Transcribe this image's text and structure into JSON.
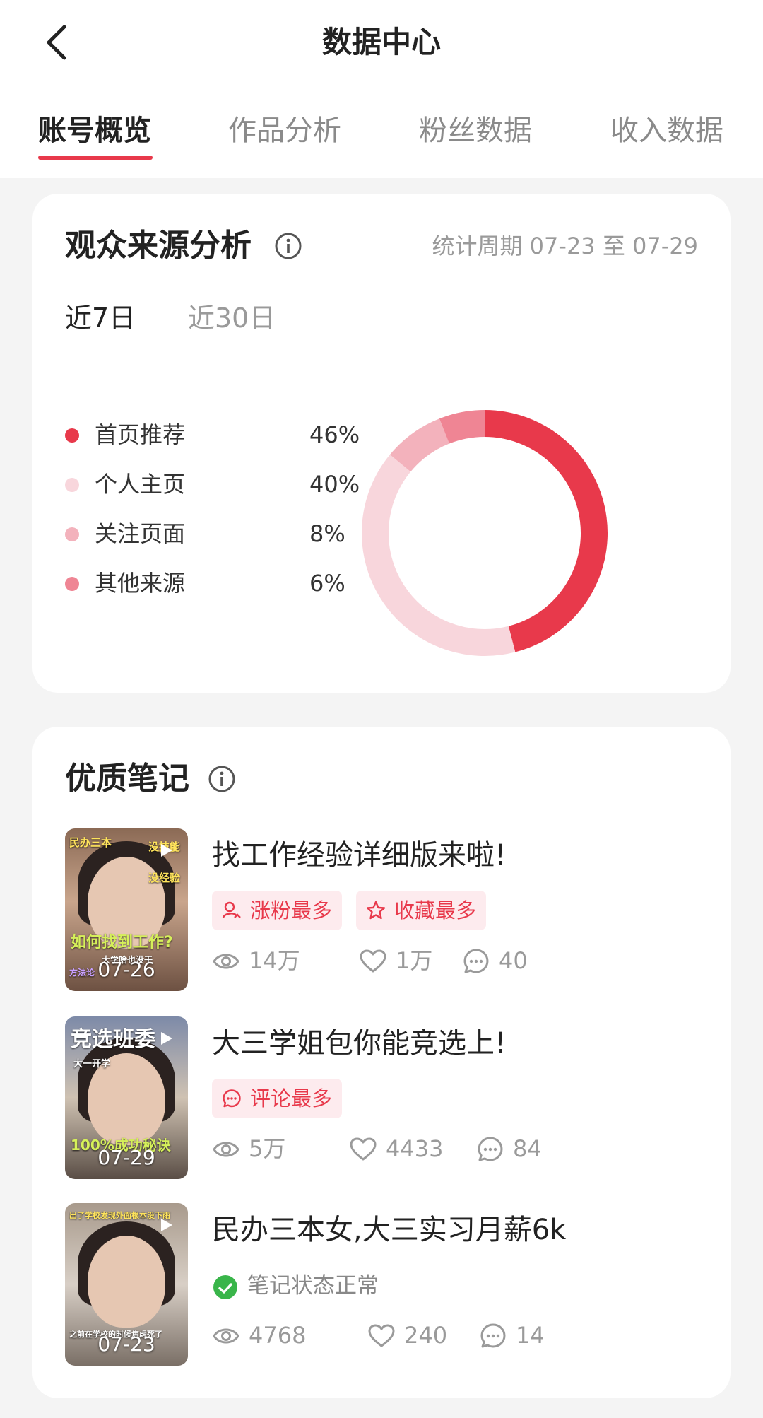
{
  "header": {
    "title": "数据中心",
    "back_icon": "chevron-left-icon"
  },
  "tabs": [
    {
      "label": "账号概览",
      "active": true
    },
    {
      "label": "作品分析",
      "active": false
    },
    {
      "label": "粉丝数据",
      "active": false
    },
    {
      "label": "收入数据",
      "active": false
    }
  ],
  "colors": {
    "accent": "#e8394b",
    "badge_bg": "#fdebee",
    "ok_green": "#39b54a"
  },
  "audience": {
    "title": "观众来源分析",
    "period": "统计周期 07-23 至 07-29",
    "ranges": [
      {
        "label": "近7日",
        "active": true
      },
      {
        "label": "近30日",
        "active": false
      }
    ],
    "legend": [
      {
        "label": "首页推荐",
        "value_text": "46%",
        "color": "#e8394b"
      },
      {
        "label": "个人主页",
        "value_text": "40%",
        "color": "#f8d6dc"
      },
      {
        "label": "关注页面",
        "value_text": "8%",
        "color": "#f3b2bc"
      },
      {
        "label": "其他来源",
        "value_text": "6%",
        "color": "#ef8594"
      }
    ]
  },
  "chart_data": {
    "type": "pie",
    "donut": true,
    "categories": [
      "首页推荐",
      "个人主页",
      "关注页面",
      "其他来源"
    ],
    "values": [
      46,
      40,
      8,
      6
    ],
    "colors": [
      "#e8394b",
      "#f8d6dc",
      "#f3b2bc",
      "#ef8594"
    ],
    "legend": "left"
  },
  "quality": {
    "title": "优质笔记",
    "notes": [
      {
        "title": "找工作经验详细版来啦!",
        "date": "07-26",
        "thumb_texts": {
          "top_left": "民办三本",
          "right1": "没技能",
          "right2": "没经验",
          "big": "如何找到工作?",
          "small": "大学啥也没干",
          "small2": "方法论"
        },
        "badges": [
          {
            "label": "涨粉最多",
            "icon": "user-plus-icon"
          },
          {
            "label": "收藏最多",
            "icon": "star-icon"
          }
        ],
        "views": "14万",
        "likes": "1万",
        "comments": "40"
      },
      {
        "title": "大三学姐包你能竞选上!",
        "date": "07-29",
        "thumb_texts": {
          "top_left": "竞选班委",
          "small": "大一开学",
          "big": "100%成功秘诀"
        },
        "badges": [
          {
            "label": "评论最多",
            "icon": "comment-icon"
          }
        ],
        "views": "5万",
        "likes": "4433",
        "comments": "84"
      },
      {
        "title": "民办三本女,大三实习月薪6k",
        "date": "07-23",
        "thumb_texts": {
          "top_left": "出了学校发现外面根本没下雨",
          "small": "之前在学校的时候焦虑死了"
        },
        "status": "笔记状态正常",
        "views": "4768",
        "likes": "240",
        "comments": "14"
      }
    ]
  }
}
